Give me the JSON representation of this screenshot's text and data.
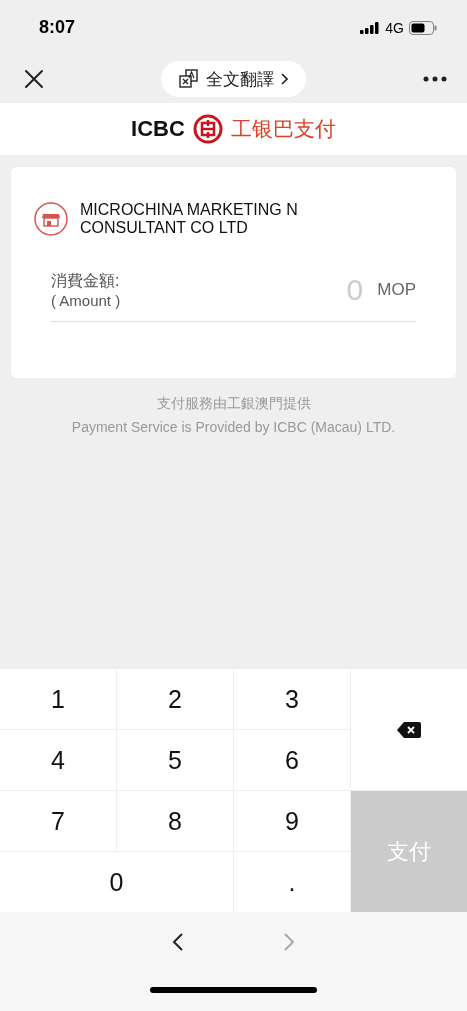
{
  "status_bar": {
    "time": "8:07",
    "network": "4G"
  },
  "nav_bar": {
    "translate_label": "全文翻譯"
  },
  "brand": {
    "name": "ICBC",
    "product": "工银巴支付"
  },
  "merchant": {
    "name": "MICROCHINA MARKETING N CONSULTANT CO LTD"
  },
  "amount": {
    "label": "消費金額:",
    "sublabel": "( Amount )",
    "placeholder": "0",
    "currency": "MOP"
  },
  "footer": {
    "line_1": "支付服務由工銀澳門提供",
    "line_2": "Payment Service is Provided by ICBC (Macau) LTD."
  },
  "keypad": {
    "keys": [
      {
        "kind": "digit",
        "label": "1"
      },
      {
        "kind": "digit",
        "label": "2"
      },
      {
        "kind": "digit",
        "label": "3"
      },
      {
        "kind": "delete"
      },
      {
        "kind": "digit",
        "label": "4"
      },
      {
        "kind": "digit",
        "label": "5"
      },
      {
        "kind": "digit",
        "label": "6"
      },
      {
        "kind": "digit",
        "label": "7"
      },
      {
        "kind": "digit",
        "label": "8"
      },
      {
        "kind": "digit",
        "label": "9"
      },
      {
        "kind": "pay",
        "label": "支付",
        "disabled": true
      },
      {
        "kind": "wide",
        "label": "0"
      },
      {
        "kind": "digit",
        "label": "."
      }
    ]
  },
  "browser_nav": {
    "back_disabled": false,
    "forward_disabled": true
  }
}
